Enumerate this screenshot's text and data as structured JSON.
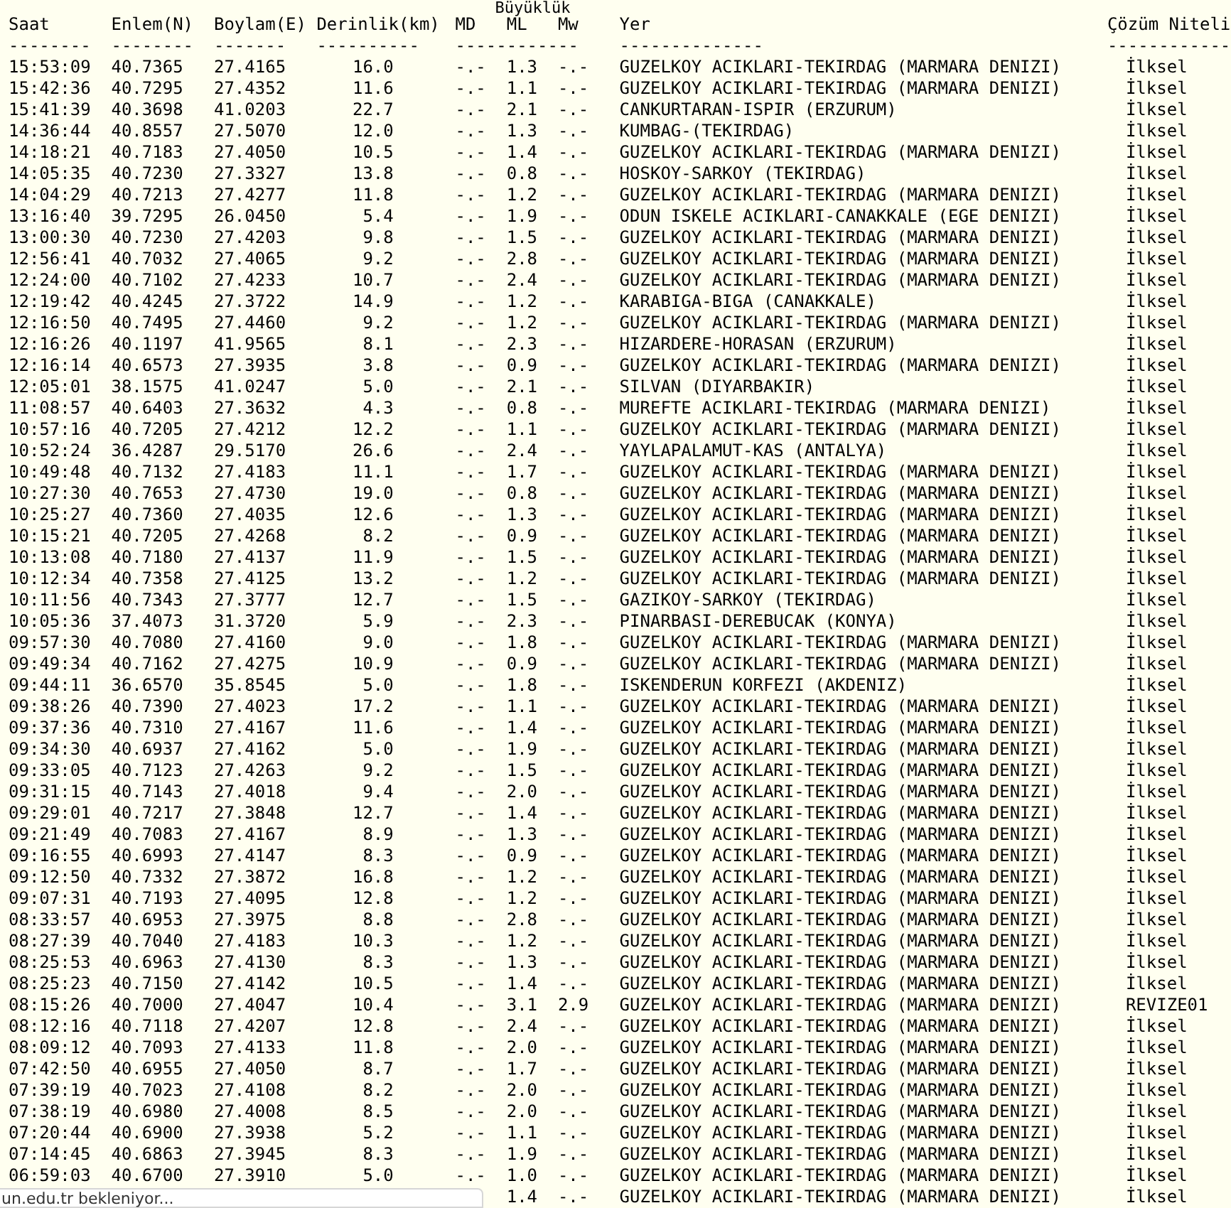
{
  "magnitude_group": "Büyüklük",
  "columns": [
    {
      "label": "Saat",
      "rule": "--------"
    },
    {
      "label": "Enlem(N)",
      "rule": "--------"
    },
    {
      "label": "Boylam(E)",
      "rule": "-------"
    },
    {
      "label": "Derinlik(km)",
      "rule": "----------"
    },
    {
      "label": "MD",
      "rule": "------------"
    },
    {
      "label": "ML"
    },
    {
      "label": "Mw"
    },
    {
      "label": "Yer",
      "rule": "--------------"
    },
    {
      "label": "Çözüm Niteli",
      "rule": "------------"
    }
  ],
  "rows": [
    {
      "time": "15:53:09",
      "lat": "40.7365",
      "lon": "27.4165",
      "depth": "16.0",
      "md": "-.-",
      "ml": "1.3",
      "mw": "-.-",
      "place": "GUZELKOY ACIKLARI-TEKIRDAG (MARMARA DENIZI)",
      "solution": "İlksel"
    },
    {
      "time": "15:42:36",
      "lat": "40.7295",
      "lon": "27.4352",
      "depth": "11.6",
      "md": "-.-",
      "ml": "1.1",
      "mw": "-.-",
      "place": "GUZELKOY ACIKLARI-TEKIRDAG (MARMARA DENIZI)",
      "solution": "İlksel"
    },
    {
      "time": "15:41:39",
      "lat": "40.3698",
      "lon": "41.0203",
      "depth": "22.7",
      "md": "-.-",
      "ml": "2.1",
      "mw": "-.-",
      "place": "CANKURTARAN-ISPIR (ERZURUM)",
      "solution": "İlksel"
    },
    {
      "time": "14:36:44",
      "lat": "40.8557",
      "lon": "27.5070",
      "depth": "12.0",
      "md": "-.-",
      "ml": "1.3",
      "mw": "-.-",
      "place": "KUMBAG-(TEKIRDAG)",
      "solution": "İlksel"
    },
    {
      "time": "14:18:21",
      "lat": "40.7183",
      "lon": "27.4050",
      "depth": "10.5",
      "md": "-.-",
      "ml": "1.4",
      "mw": "-.-",
      "place": "GUZELKOY ACIKLARI-TEKIRDAG (MARMARA DENIZI)",
      "solution": "İlksel"
    },
    {
      "time": "14:05:35",
      "lat": "40.7230",
      "lon": "27.3327",
      "depth": "13.8",
      "md": "-.-",
      "ml": "0.8",
      "mw": "-.-",
      "place": "HOSKOY-SARKOY (TEKIRDAG)",
      "solution": "İlksel"
    },
    {
      "time": "14:04:29",
      "lat": "40.7213",
      "lon": "27.4277",
      "depth": "11.8",
      "md": "-.-",
      "ml": "1.2",
      "mw": "-.-",
      "place": "GUZELKOY ACIKLARI-TEKIRDAG (MARMARA DENIZI)",
      "solution": "İlksel"
    },
    {
      "time": "13:16:40",
      "lat": "39.7295",
      "lon": "26.0450",
      "depth": "5.4",
      "md": "-.-",
      "ml": "1.9",
      "mw": "-.-",
      "place": "ODUN ISKELE ACIKLARI-CANAKKALE (EGE DENIZI)",
      "solution": "İlksel"
    },
    {
      "time": "13:00:30",
      "lat": "40.7230",
      "lon": "27.4203",
      "depth": "9.8",
      "md": "-.-",
      "ml": "1.5",
      "mw": "-.-",
      "place": "GUZELKOY ACIKLARI-TEKIRDAG (MARMARA DENIZI)",
      "solution": "İlksel"
    },
    {
      "time": "12:56:41",
      "lat": "40.7032",
      "lon": "27.4065",
      "depth": "9.2",
      "md": "-.-",
      "ml": "2.8",
      "mw": "-.-",
      "place": "GUZELKOY ACIKLARI-TEKIRDAG (MARMARA DENIZI)",
      "solution": "İlksel"
    },
    {
      "time": "12:24:00",
      "lat": "40.7102",
      "lon": "27.4233",
      "depth": "10.7",
      "md": "-.-",
      "ml": "2.4",
      "mw": "-.-",
      "place": "GUZELKOY ACIKLARI-TEKIRDAG (MARMARA DENIZI)",
      "solution": "İlksel"
    },
    {
      "time": "12:19:42",
      "lat": "40.4245",
      "lon": "27.3722",
      "depth": "14.9",
      "md": "-.-",
      "ml": "1.2",
      "mw": "-.-",
      "place": "KARABIGA-BIGA (CANAKKALE)",
      "solution": "İlksel"
    },
    {
      "time": "12:16:50",
      "lat": "40.7495",
      "lon": "27.4460",
      "depth": "9.2",
      "md": "-.-",
      "ml": "1.2",
      "mw": "-.-",
      "place": "GUZELKOY ACIKLARI-TEKIRDAG (MARMARA DENIZI)",
      "solution": "İlksel"
    },
    {
      "time": "12:16:26",
      "lat": "40.1197",
      "lon": "41.9565",
      "depth": "8.1",
      "md": "-.-",
      "ml": "2.3",
      "mw": "-.-",
      "place": "HIZARDERE-HORASAN (ERZURUM)",
      "solution": "İlksel"
    },
    {
      "time": "12:16:14",
      "lat": "40.6573",
      "lon": "27.3935",
      "depth": "3.8",
      "md": "-.-",
      "ml": "0.9",
      "mw": "-.-",
      "place": "GUZELKOY ACIKLARI-TEKIRDAG (MARMARA DENIZI)",
      "solution": "İlksel"
    },
    {
      "time": "12:05:01",
      "lat": "38.1575",
      "lon": "41.0247",
      "depth": "5.0",
      "md": "-.-",
      "ml": "2.1",
      "mw": "-.-",
      "place": "SILVAN (DIYARBAKIR)",
      "solution": "İlksel"
    },
    {
      "time": "11:08:57",
      "lat": "40.6403",
      "lon": "27.3632",
      "depth": "4.3",
      "md": "-.-",
      "ml": "0.8",
      "mw": "-.-",
      "place": "MUREFTE ACIKLARI-TEKIRDAG (MARMARA DENIZI)",
      "solution": "İlksel"
    },
    {
      "time": "10:57:16",
      "lat": "40.7205",
      "lon": "27.4212",
      "depth": "12.2",
      "md": "-.-",
      "ml": "1.1",
      "mw": "-.-",
      "place": "GUZELKOY ACIKLARI-TEKIRDAG (MARMARA DENIZI)",
      "solution": "İlksel"
    },
    {
      "time": "10:52:24",
      "lat": "36.4287",
      "lon": "29.5170",
      "depth": "26.6",
      "md": "-.-",
      "ml": "2.4",
      "mw": "-.-",
      "place": "YAYLAPALAMUT-KAS (ANTALYA)",
      "solution": "İlksel"
    },
    {
      "time": "10:49:48",
      "lat": "40.7132",
      "lon": "27.4183",
      "depth": "11.1",
      "md": "-.-",
      "ml": "1.7",
      "mw": "-.-",
      "place": "GUZELKOY ACIKLARI-TEKIRDAG (MARMARA DENIZI)",
      "solution": "İlksel"
    },
    {
      "time": "10:27:30",
      "lat": "40.7653",
      "lon": "27.4730",
      "depth": "19.0",
      "md": "-.-",
      "ml": "0.8",
      "mw": "-.-",
      "place": "GUZELKOY ACIKLARI-TEKIRDAG (MARMARA DENIZI)",
      "solution": "İlksel"
    },
    {
      "time": "10:25:27",
      "lat": "40.7360",
      "lon": "27.4035",
      "depth": "12.6",
      "md": "-.-",
      "ml": "1.3",
      "mw": "-.-",
      "place": "GUZELKOY ACIKLARI-TEKIRDAG (MARMARA DENIZI)",
      "solution": "İlksel"
    },
    {
      "time": "10:15:21",
      "lat": "40.7205",
      "lon": "27.4268",
      "depth": "8.2",
      "md": "-.-",
      "ml": "0.9",
      "mw": "-.-",
      "place": "GUZELKOY ACIKLARI-TEKIRDAG (MARMARA DENIZI)",
      "solution": "İlksel"
    },
    {
      "time": "10:13:08",
      "lat": "40.7180",
      "lon": "27.4137",
      "depth": "11.9",
      "md": "-.-",
      "ml": "1.5",
      "mw": "-.-",
      "place": "GUZELKOY ACIKLARI-TEKIRDAG (MARMARA DENIZI)",
      "solution": "İlksel"
    },
    {
      "time": "10:12:34",
      "lat": "40.7358",
      "lon": "27.4125",
      "depth": "13.2",
      "md": "-.-",
      "ml": "1.2",
      "mw": "-.-",
      "place": "GUZELKOY ACIKLARI-TEKIRDAG (MARMARA DENIZI)",
      "solution": "İlksel"
    },
    {
      "time": "10:11:56",
      "lat": "40.7343",
      "lon": "27.3777",
      "depth": "12.7",
      "md": "-.-",
      "ml": "1.5",
      "mw": "-.-",
      "place": "GAZIKOY-SARKOY (TEKIRDAG)",
      "solution": "İlksel"
    },
    {
      "time": "10:05:36",
      "lat": "37.4073",
      "lon": "31.3720",
      "depth": "5.9",
      "md": "-.-",
      "ml": "2.3",
      "mw": "-.-",
      "place": "PINARBASI-DEREBUCAK (KONYA)",
      "solution": "İlksel"
    },
    {
      "time": "09:57:30",
      "lat": "40.7080",
      "lon": "27.4160",
      "depth": "9.0",
      "md": "-.-",
      "ml": "1.8",
      "mw": "-.-",
      "place": "GUZELKOY ACIKLARI-TEKIRDAG (MARMARA DENIZI)",
      "solution": "İlksel"
    },
    {
      "time": "09:49:34",
      "lat": "40.7162",
      "lon": "27.4275",
      "depth": "10.9",
      "md": "-.-",
      "ml": "0.9",
      "mw": "-.-",
      "place": "GUZELKOY ACIKLARI-TEKIRDAG (MARMARA DENIZI)",
      "solution": "İlksel"
    },
    {
      "time": "09:44:11",
      "lat": "36.6570",
      "lon": "35.8545",
      "depth": "5.0",
      "md": "-.-",
      "ml": "1.8",
      "mw": "-.-",
      "place": "ISKENDERUN KORFEZI (AKDENIZ)",
      "solution": "İlksel"
    },
    {
      "time": "09:38:26",
      "lat": "40.7390",
      "lon": "27.4023",
      "depth": "17.2",
      "md": "-.-",
      "ml": "1.1",
      "mw": "-.-",
      "place": "GUZELKOY ACIKLARI-TEKIRDAG (MARMARA DENIZI)",
      "solution": "İlksel"
    },
    {
      "time": "09:37:36",
      "lat": "40.7310",
      "lon": "27.4167",
      "depth": "11.6",
      "md": "-.-",
      "ml": "1.4",
      "mw": "-.-",
      "place": "GUZELKOY ACIKLARI-TEKIRDAG (MARMARA DENIZI)",
      "solution": "İlksel"
    },
    {
      "time": "09:34:30",
      "lat": "40.6937",
      "lon": "27.4162",
      "depth": "5.0",
      "md": "-.-",
      "ml": "1.9",
      "mw": "-.-",
      "place": "GUZELKOY ACIKLARI-TEKIRDAG (MARMARA DENIZI)",
      "solution": "İlksel"
    },
    {
      "time": "09:33:05",
      "lat": "40.7123",
      "lon": "27.4263",
      "depth": "9.2",
      "md": "-.-",
      "ml": "1.5",
      "mw": "-.-",
      "place": "GUZELKOY ACIKLARI-TEKIRDAG (MARMARA DENIZI)",
      "solution": "İlksel"
    },
    {
      "time": "09:31:15",
      "lat": "40.7143",
      "lon": "27.4018",
      "depth": "9.4",
      "md": "-.-",
      "ml": "2.0",
      "mw": "-.-",
      "place": "GUZELKOY ACIKLARI-TEKIRDAG (MARMARA DENIZI)",
      "solution": "İlksel"
    },
    {
      "time": "09:29:01",
      "lat": "40.7217",
      "lon": "27.3848",
      "depth": "12.7",
      "md": "-.-",
      "ml": "1.4",
      "mw": "-.-",
      "place": "GUZELKOY ACIKLARI-TEKIRDAG (MARMARA DENIZI)",
      "solution": "İlksel"
    },
    {
      "time": "09:21:49",
      "lat": "40.7083",
      "lon": "27.4167",
      "depth": "8.9",
      "md": "-.-",
      "ml": "1.3",
      "mw": "-.-",
      "place": "GUZELKOY ACIKLARI-TEKIRDAG (MARMARA DENIZI)",
      "solution": "İlksel"
    },
    {
      "time": "09:16:55",
      "lat": "40.6993",
      "lon": "27.4147",
      "depth": "8.3",
      "md": "-.-",
      "ml": "0.9",
      "mw": "-.-",
      "place": "GUZELKOY ACIKLARI-TEKIRDAG (MARMARA DENIZI)",
      "solution": "İlksel"
    },
    {
      "time": "09:12:50",
      "lat": "40.7332",
      "lon": "27.3872",
      "depth": "16.8",
      "md": "-.-",
      "ml": "1.2",
      "mw": "-.-",
      "place": "GUZELKOY ACIKLARI-TEKIRDAG (MARMARA DENIZI)",
      "solution": "İlksel"
    },
    {
      "time": "09:07:31",
      "lat": "40.7193",
      "lon": "27.4095",
      "depth": "12.8",
      "md": "-.-",
      "ml": "1.2",
      "mw": "-.-",
      "place": "GUZELKOY ACIKLARI-TEKIRDAG (MARMARA DENIZI)",
      "solution": "İlksel"
    },
    {
      "time": "08:33:57",
      "lat": "40.6953",
      "lon": "27.3975",
      "depth": "8.8",
      "md": "-.-",
      "ml": "2.8",
      "mw": "-.-",
      "place": "GUZELKOY ACIKLARI-TEKIRDAG (MARMARA DENIZI)",
      "solution": "İlksel"
    },
    {
      "time": "08:27:39",
      "lat": "40.7040",
      "lon": "27.4183",
      "depth": "10.3",
      "md": "-.-",
      "ml": "1.2",
      "mw": "-.-",
      "place": "GUZELKOY ACIKLARI-TEKIRDAG (MARMARA DENIZI)",
      "solution": "İlksel"
    },
    {
      "time": "08:25:53",
      "lat": "40.6963",
      "lon": "27.4130",
      "depth": "8.3",
      "md": "-.-",
      "ml": "1.3",
      "mw": "-.-",
      "place": "GUZELKOY ACIKLARI-TEKIRDAG (MARMARA DENIZI)",
      "solution": "İlksel"
    },
    {
      "time": "08:25:23",
      "lat": "40.7150",
      "lon": "27.4142",
      "depth": "10.5",
      "md": "-.-",
      "ml": "1.4",
      "mw": "-.-",
      "place": "GUZELKOY ACIKLARI-TEKIRDAG (MARMARA DENIZI)",
      "solution": "İlksel"
    },
    {
      "time": "08:15:26",
      "lat": "40.7000",
      "lon": "27.4047",
      "depth": "10.4",
      "md": "-.-",
      "ml": "3.1",
      "mw": "2.9",
      "place": "GUZELKOY ACIKLARI-TEKIRDAG (MARMARA DENIZI)",
      "solution": "REVIZE01"
    },
    {
      "time": "08:12:16",
      "lat": "40.7118",
      "lon": "27.4207",
      "depth": "12.8",
      "md": "-.-",
      "ml": "2.4",
      "mw": "-.-",
      "place": "GUZELKOY ACIKLARI-TEKIRDAG (MARMARA DENIZI)",
      "solution": "İlksel"
    },
    {
      "time": "08:09:12",
      "lat": "40.7093",
      "lon": "27.4133",
      "depth": "11.8",
      "md": "-.-",
      "ml": "2.0",
      "mw": "-.-",
      "place": "GUZELKOY ACIKLARI-TEKIRDAG (MARMARA DENIZI)",
      "solution": "İlksel"
    },
    {
      "time": "07:42:50",
      "lat": "40.6955",
      "lon": "27.4050",
      "depth": "8.7",
      "md": "-.-",
      "ml": "1.7",
      "mw": "-.-",
      "place": "GUZELKOY ACIKLARI-TEKIRDAG (MARMARA DENIZI)",
      "solution": "İlksel"
    },
    {
      "time": "07:39:19",
      "lat": "40.7023",
      "lon": "27.4108",
      "depth": "8.2",
      "md": "-.-",
      "ml": "2.0",
      "mw": "-.-",
      "place": "GUZELKOY ACIKLARI-TEKIRDAG (MARMARA DENIZI)",
      "solution": "İlksel"
    },
    {
      "time": "07:38:19",
      "lat": "40.6980",
      "lon": "27.4008",
      "depth": "8.5",
      "md": "-.-",
      "ml": "2.0",
      "mw": "-.-",
      "place": "GUZELKOY ACIKLARI-TEKIRDAG (MARMARA DENIZI)",
      "solution": "İlksel"
    },
    {
      "time": "07:20:44",
      "lat": "40.6900",
      "lon": "27.3938",
      "depth": "5.2",
      "md": "-.-",
      "ml": "1.1",
      "mw": "-.-",
      "place": "GUZELKOY ACIKLARI-TEKIRDAG (MARMARA DENIZI)",
      "solution": "İlksel"
    },
    {
      "time": "07:14:45",
      "lat": "40.6863",
      "lon": "27.3945",
      "depth": "8.3",
      "md": "-.-",
      "ml": "1.9",
      "mw": "-.-",
      "place": "GUZELKOY ACIKLARI-TEKIRDAG (MARMARA DENIZI)",
      "solution": "İlksel"
    },
    {
      "time": "06:59:03",
      "lat": "40.6700",
      "lon": "27.3910",
      "depth": "5.0",
      "md": "-.-",
      "ml": "1.0",
      "mw": "-.-",
      "place": "GUZELKOY ACIKLARI-TEKIRDAG (MARMARA DENIZI)",
      "solution": "İlksel"
    },
    {
      "ml": "1.4",
      "mw": "-.-",
      "place": "GUZELKOY ACIKLARI-TEKIRDAG (MARMARA DENIZI)",
      "solution": "İlksel"
    }
  ],
  "status_bubble": "un.edu.tr bekleniyor..."
}
